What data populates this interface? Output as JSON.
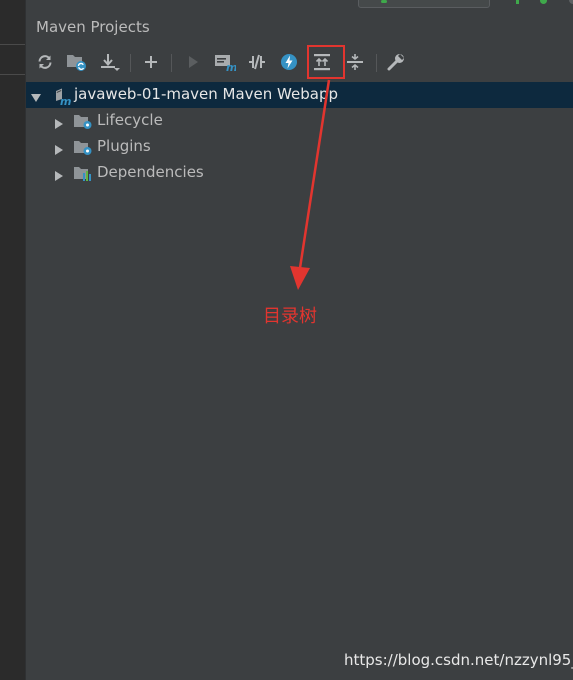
{
  "panel": {
    "title": "Maven Projects"
  },
  "toolbar": {
    "buttons": [
      {
        "icon": "refresh-icon"
      },
      {
        "icon": "generate-sources-icon"
      },
      {
        "icon": "download-icon"
      },
      {
        "icon": "add-icon"
      },
      {
        "icon": "run-icon"
      },
      {
        "icon": "execute-goal-icon"
      },
      {
        "icon": "toggle-offline-icon"
      },
      {
        "icon": "skip-tests-icon"
      },
      {
        "icon": "expand-all-icon"
      },
      {
        "icon": "collapse-all-icon"
      },
      {
        "icon": "settings-wrench-icon"
      }
    ]
  },
  "tree": {
    "root": {
      "label": "javaweb-01-maven Maven Webapp",
      "expanded": true
    },
    "children": [
      {
        "label": "Lifecycle",
        "icon": "lifecycle-folder-icon"
      },
      {
        "label": "Plugins",
        "icon": "plugins-folder-icon"
      },
      {
        "label": "Dependencies",
        "icon": "dependencies-folder-icon"
      }
    ]
  },
  "annotation": {
    "text": "目录树"
  },
  "watermark": {
    "text": "https://blog.csdn.net/nzzynl95_"
  },
  "colors": {
    "panel_bg": "#3c3f41",
    "selection_bg": "#0d293e",
    "annotation_red": "#e2352f",
    "text": "#bbbbbb",
    "icon_blue": "#3592c4"
  }
}
